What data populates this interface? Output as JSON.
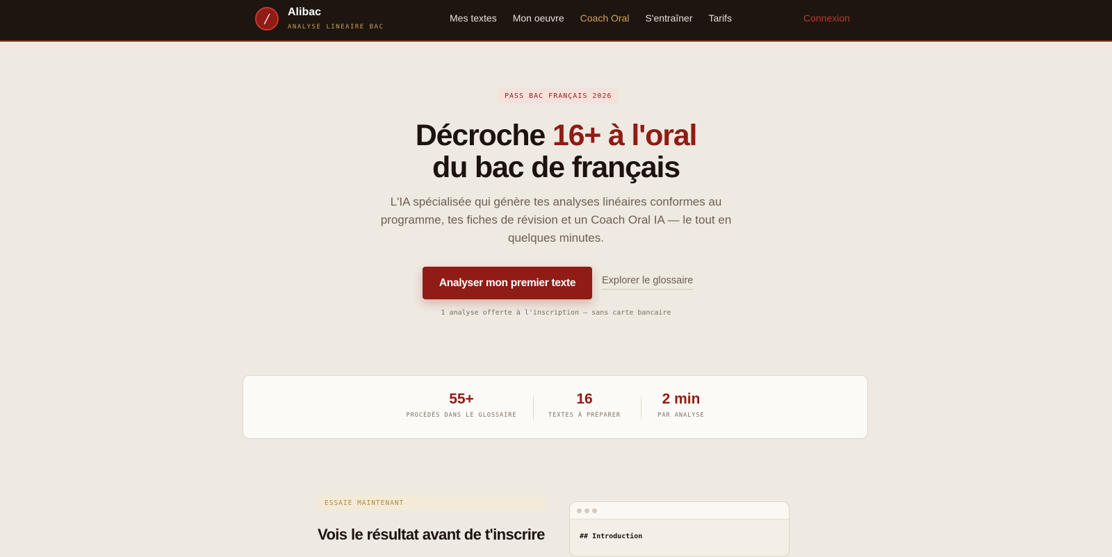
{
  "nav": {
    "logo_glyph": "/",
    "brand_name": "Alibac",
    "brand_sub": "ANALYSE LINEAIRE BAC",
    "links": [
      "Mes textes",
      "Mon oeuvre",
      "Coach Oral",
      "S'entraîner",
      "Tarifs"
    ],
    "active_link": "Coach Oral",
    "login": "Connexion"
  },
  "hero": {
    "badge": "PASS BAC FRANÇAIS 2026",
    "title_part1": "Décroche ",
    "title_accent": "16+ à l'oral",
    "title_line2": "du bac de français",
    "lead": "L'IA spécialisée qui génère tes analyses linéaires conformes au programme, tes fiches de révision et un Coach Oral IA — le tout en quelques minutes.",
    "cta_primary": "Analyser mon premier texte",
    "cta_secondary": "Explorer le glossaire",
    "note": "1 analyse offerte à l'inscription — sans carte bancaire"
  },
  "stats": [
    {
      "value": "55+",
      "label": "PROCÉDÉS DANS LE GLOSSAIRE"
    },
    {
      "value": "16",
      "label": "TEXTES À PRÉPARER"
    },
    {
      "value": "2 min",
      "label": "PAR ANALYSE"
    }
  ],
  "demo": {
    "tag": "ESSAIE MAINTENANT",
    "title": "Vois le résultat avant de t'inscrire",
    "window_text": "## Introduction"
  },
  "colors": {
    "accent": "#8f1c15",
    "nav_bg": "#1d150f",
    "page_bg": "#eee9e1",
    "gold": "#d7a35a"
  }
}
